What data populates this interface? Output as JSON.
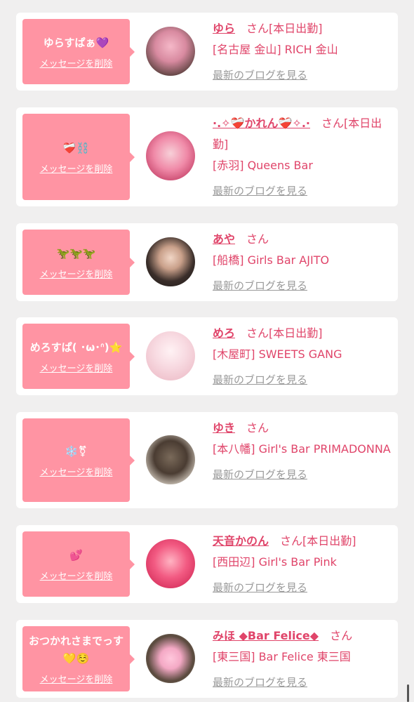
{
  "cards": [
    {
      "bubble_text": "ゆらすぱぁ💜",
      "delete_label": "メッセージを削除",
      "name": "ゆら",
      "honorific": "さん",
      "attendance": "[本日出勤]",
      "shop": "[名古屋 金山] RICH 金山",
      "blog_label": "最新のブログを見る"
    },
    {
      "bubble_text": "❤️‍🩹⛓️",
      "delete_label": "メッセージを削除",
      "name": "·.✧❤️‍🩹かれん❤️‍🩹✧.·",
      "honorific": "さん",
      "attendance": "[本日出勤]",
      "shop": "[赤羽] Queens Bar",
      "blog_label": "最新のブログを見る"
    },
    {
      "bubble_text": "🦖🦖🦖",
      "delete_label": "メッセージを削除",
      "name": "あや",
      "honorific": "さん",
      "attendance": "",
      "shop": "[船橋] Girls Bar AJITO",
      "blog_label": "最新のブログを見る"
    },
    {
      "bubble_text": "めろすぱ( ･ω･ᐢ)⭐️",
      "delete_label": "メッセージを削除",
      "name": "めろ",
      "honorific": "さん",
      "attendance": "[本日出勤]",
      "shop": "[木屋町] SWEETS GANG",
      "blog_label": "最新のブログを見る"
    },
    {
      "bubble_text": "❄️⚧",
      "delete_label": "メッセージを削除",
      "name": "ゆき",
      "honorific": "さん",
      "attendance": "",
      "shop": "[本八幡] Girl's Bar PRIMADONNA",
      "blog_label": "最新のブログを見る"
    },
    {
      "bubble_text": "💕",
      "delete_label": "メッセージを削除",
      "name": "天音かのん",
      "honorific": "さん",
      "attendance": "[本日出勤]",
      "shop": "[西田辺] Girl's Bar Pink",
      "blog_label": "最新のブログを見る"
    },
    {
      "bubble_text": "おつかれさまでっす💛☺️",
      "delete_label": "メッセージを削除",
      "name": "みほ ◆Bar Felice◆",
      "honorific": "さん",
      "attendance": "",
      "shop": "[東三国] Bar Felice 東三国",
      "blog_label": "最新のブログを見る"
    }
  ],
  "colors": {
    "bubble": "#ff94a3",
    "accent": "#e0456a",
    "muted": "#9a9a9a",
    "background": "#f0efef"
  }
}
